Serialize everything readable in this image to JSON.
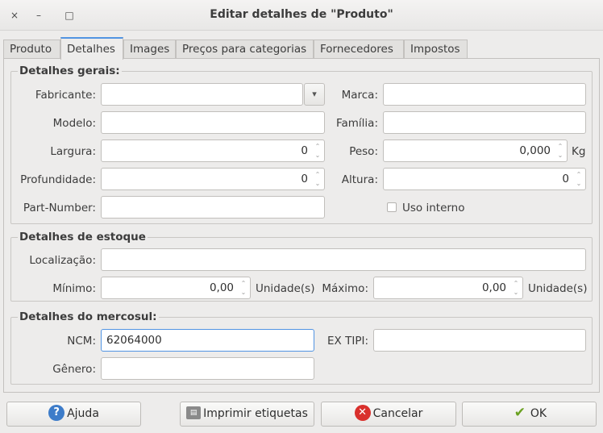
{
  "window": {
    "title": "Editar detalhes de \"Produto\"",
    "close_glyph": "×",
    "minimize_glyph": "–",
    "maximize_glyph": "□"
  },
  "tabs": [
    {
      "label": "Produto"
    },
    {
      "label": "Detalhes"
    },
    {
      "label": "Images"
    },
    {
      "label": "Preços para categorias"
    },
    {
      "label": "Fornecedores"
    },
    {
      "label": "Impostos"
    }
  ],
  "gerais": {
    "title": "Detalhes gerais:",
    "fabricante_label": "Fabricante:",
    "fabricante_value": "",
    "marca_label": "Marca:",
    "marca_value": "",
    "modelo_label": "Modelo:",
    "modelo_value": "",
    "familia_label": "Família:",
    "familia_value": "",
    "largura_label": "Largura:",
    "largura_value": "0",
    "peso_label": "Peso:",
    "peso_value": "0,000",
    "peso_unit": "Kg",
    "profundidade_label": "Profundidade:",
    "profundidade_value": "0",
    "altura_label": "Altura:",
    "altura_value": "0",
    "partnumber_label": "Part-Number:",
    "partnumber_value": "",
    "uso_interno_label": "Uso interno"
  },
  "estoque": {
    "title": "Detalhes de estoque",
    "localizacao_label": "Localização:",
    "localizacao_value": "",
    "minimo_label": "Mínimo:",
    "minimo_value": "0,00",
    "minimo_unit": "Unidade(s)",
    "maximo_label": "Máximo:",
    "maximo_value": "0,00",
    "maximo_unit": "Unidade(s)"
  },
  "mercosul": {
    "title": "Detalhes do mercosul:",
    "ncm_label": "NCM:",
    "ncm_value": "62064000",
    "extipi_label": "EX TIPI:",
    "extipi_value": "",
    "genero_label": "Gênero:",
    "genero_value": ""
  },
  "buttons": {
    "ajuda": "Ajuda",
    "imprimir": "Imprimir etiquetas",
    "cancelar": "Cancelar",
    "ok": "OK"
  },
  "colors": {
    "accent": "#5294e2",
    "help_icon": "#3d7cc9",
    "cancel_icon": "#d9302c",
    "ok_icon": "#6aa121"
  },
  "icons": {
    "help": "help-icon",
    "print": "printer-icon",
    "cancel": "cancel-icon",
    "ok": "checkmark-icon",
    "dropdown": "chevron-down-icon",
    "spin": "spin-arrows-icon"
  }
}
